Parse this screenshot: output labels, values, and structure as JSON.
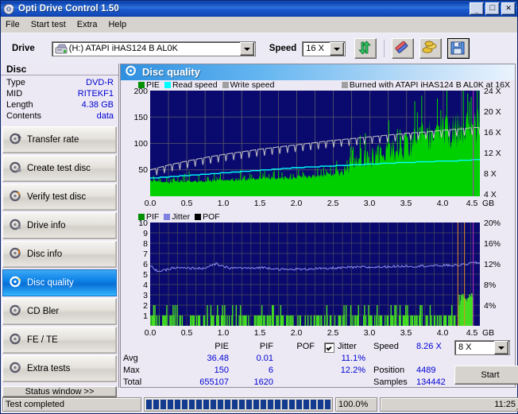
{
  "window": {
    "title": "Opti Drive Control 1.50",
    "icon": "disc-icon",
    "minimize": "_",
    "maximize": "□",
    "close": "✕"
  },
  "menu": {
    "items": [
      "File",
      "Start test",
      "Extra",
      "Help"
    ]
  },
  "toolbar": {
    "drive_label": "Drive",
    "drive_value": "(H:)  ATAPI iHAS124   B AL0K",
    "speed_label": "Speed",
    "speed_value": "16 X",
    "buttons": [
      {
        "name": "refresh-button",
        "icon": "refresh-icon"
      },
      {
        "name": "erase-button",
        "icon": "eraser-icon"
      },
      {
        "name": "bitsetting-button",
        "icon": "coins-icon"
      },
      {
        "name": "save-button",
        "icon": "floppy-save-icon"
      }
    ]
  },
  "sidebar": {
    "disc_header": "Disc",
    "disc_info": [
      {
        "key": "Type",
        "value": "DVD-R"
      },
      {
        "key": "MID",
        "value": "RITEKF1"
      },
      {
        "key": "Length",
        "value": "4.38 GB"
      },
      {
        "key": "Contents",
        "value": "data"
      }
    ],
    "nav": [
      {
        "label": "Transfer rate",
        "active": false
      },
      {
        "label": "Create test disc",
        "active": false
      },
      {
        "label": "Verify test disc",
        "active": false
      },
      {
        "label": "Drive info",
        "active": false
      },
      {
        "label": "Disc info",
        "active": false
      },
      {
        "label": "Disc quality",
        "active": true
      },
      {
        "label": "CD Bler",
        "active": false
      },
      {
        "label": "FE / TE",
        "active": false
      },
      {
        "label": "Extra tests",
        "active": false
      }
    ],
    "status_window_button": "Status window >>"
  },
  "panel": {
    "title": "Disc quality",
    "icon": "disc-quality-icon"
  },
  "chart_data": [
    {
      "type": "area",
      "id": "pie-chart",
      "title": "",
      "legend": [
        {
          "label": "PIE",
          "color": "#009000"
        },
        {
          "label": "Read speed",
          "color": "#00ffff"
        },
        {
          "label": "Write speed",
          "color": "#a0a0a0"
        }
      ],
      "annotation": {
        "label": "Burned with ATAPI iHAS124   B AL0K at 16X",
        "color": "#a0a0a0"
      },
      "xlabel": "GB",
      "x_ticks": [
        "0.0",
        "0.5",
        "1.0",
        "1.5",
        "2.0",
        "2.5",
        "3.0",
        "3.5",
        "4.0",
        "4.5"
      ],
      "xlim": [
        0.0,
        4.5
      ],
      "ylabel_left": "PIE",
      "y_ticks_left": [
        "50",
        "100",
        "150",
        "200"
      ],
      "ylim_left": [
        0,
        200
      ],
      "ylabel_right": "Speed",
      "y_ticks_right": [
        "4 X",
        "8 X",
        "12 X",
        "16 X",
        "20 X",
        "24 X"
      ],
      "ylim_right": [
        0,
        24
      ],
      "grid": true,
      "plot_bg": "#0a0a6e",
      "series": [
        {
          "name": "PIE",
          "color": "#00d000",
          "x": [
            0.0,
            0.1,
            0.2,
            0.3,
            0.4,
            0.5,
            0.6,
            0.7,
            0.8,
            0.9,
            1.0,
            1.1,
            1.2,
            1.3,
            1.4,
            1.5,
            1.6,
            1.7,
            1.8,
            1.9,
            2.0,
            2.1,
            2.2,
            2.3,
            2.4,
            2.5,
            2.6,
            2.7,
            2.8,
            2.9,
            3.0,
            3.1,
            3.2,
            3.3,
            3.4,
            3.5,
            3.6,
            3.7,
            3.8,
            3.9,
            4.0,
            4.1,
            4.2,
            4.3,
            4.4
          ],
          "values": [
            30,
            27,
            26,
            27,
            28,
            28,
            29,
            29,
            30,
            30,
            31,
            31,
            32,
            33,
            33,
            34,
            34,
            35,
            34,
            35,
            36,
            37,
            38,
            38,
            40,
            44,
            52,
            58,
            62,
            66,
            70,
            76,
            82,
            86,
            92,
            98,
            104,
            110,
            112,
            118,
            120,
            126,
            130,
            132,
            136
          ]
        },
        {
          "name": "Read speed",
          "color": "#00ffff",
          "x": [
            0.0,
            0.25,
            0.5,
            0.75,
            1.0,
            1.25,
            1.5,
            1.75,
            2.0,
            2.25,
            2.5,
            2.75,
            3.0,
            3.25,
            3.5,
            3.75,
            4.0,
            4.25,
            4.4
          ],
          "values": [
            4.1,
            4.4,
            4.7,
            5.0,
            5.3,
            5.6,
            5.9,
            6.2,
            6.5,
            6.7,
            6.9,
            7.1,
            7.3,
            7.5,
            7.7,
            7.8,
            8.0,
            8.1,
            8.26
          ]
        },
        {
          "name": "Write speed",
          "color": "#b8b8b8",
          "x": [
            0.0,
            0.25,
            0.5,
            0.75,
            1.0,
            1.25,
            1.5,
            1.75,
            2.0,
            2.25,
            2.5,
            2.75,
            3.0,
            3.25,
            3.5,
            3.75,
            4.0,
            4.25,
            4.4
          ],
          "values": [
            6.0,
            7.1,
            8.0,
            8.8,
            9.5,
            10.1,
            10.7,
            11.2,
            11.7,
            12.2,
            12.7,
            13.1,
            13.5,
            13.9,
            14.3,
            14.6,
            15.0,
            15.3,
            15.6
          ]
        }
      ]
    },
    {
      "type": "bar",
      "id": "pif-chart",
      "title": "",
      "legend": [
        {
          "label": "PIF",
          "color": "#009000"
        },
        {
          "label": "Jitter",
          "color": "#8080e0"
        },
        {
          "label": "POF",
          "color": "#000000"
        }
      ],
      "xlabel": "GB",
      "x_ticks": [
        "0.0",
        "0.5",
        "1.0",
        "1.5",
        "2.0",
        "2.5",
        "3.0",
        "3.5",
        "4.0",
        "4.5"
      ],
      "xlim": [
        0.0,
        4.5
      ],
      "ylabel_left": "PIF",
      "y_ticks_left": [
        "1",
        "2",
        "3",
        "4",
        "5",
        "6",
        "7",
        "8",
        "9",
        "10"
      ],
      "ylim_left": [
        0,
        10
      ],
      "ylabel_right": "Jitter",
      "y_ticks_right": [
        "4%",
        "8%",
        "12%",
        "16%",
        "20%"
      ],
      "ylim_right": [
        0,
        20
      ],
      "grid": true,
      "plot_bg": "#0a0a6e",
      "series": [
        {
          "name": "Jitter",
          "color": "#8888ee",
          "x": [
            0.0,
            0.1,
            0.2,
            0.3,
            0.4,
            0.5,
            0.6,
            0.7,
            0.8,
            0.9,
            1.0,
            1.1,
            1.2,
            1.3,
            1.4,
            1.5,
            1.6,
            1.7,
            1.8,
            1.9,
            2.0,
            2.1,
            2.2,
            2.3,
            2.4,
            2.5,
            2.6,
            2.7,
            2.8,
            2.9,
            3.0,
            3.1,
            3.2,
            3.3,
            3.4,
            3.5,
            3.6,
            3.7,
            3.8,
            3.9,
            4.0,
            4.1,
            4.2,
            4.3,
            4.4
          ],
          "values": [
            11.6,
            10.6,
            10.7,
            11.2,
            11.2,
            11.1,
            11.2,
            11.1,
            11.4,
            12.0,
            11.4,
            11.2,
            11.2,
            11.2,
            11.1,
            11.3,
            11.2,
            11.1,
            10.9,
            10.9,
            11.0,
            10.9,
            11.1,
            11.1,
            11.0,
            11.2,
            11.2,
            11.3,
            11.3,
            11.4,
            11.3,
            11.4,
            11.4,
            11.5,
            11.5,
            11.6,
            11.5,
            11.6,
            11.6,
            11.6,
            11.7,
            11.7,
            11.7,
            11.9,
            12.2
          ]
        },
        {
          "name": "PIF",
          "color": "#00d000",
          "note": "sparse spikes mostly 1-2, rising to 3 near 4.3 GB"
        }
      ]
    }
  ],
  "stats": {
    "columns": [
      "PIE",
      "PIF",
      "POF",
      "Jitter"
    ],
    "jitter_checkbox_checked": true,
    "rows": [
      {
        "label": "Avg",
        "pie": "36.48",
        "pif": "0.01",
        "pof": "",
        "jitter": "11.1%"
      },
      {
        "label": "Max",
        "pie": "150",
        "pif": "6",
        "pof": "",
        "jitter": "12.2%"
      },
      {
        "label": "Total",
        "pie": "655107",
        "pif": "1620",
        "pof": "",
        "jitter": ""
      }
    ],
    "info": [
      {
        "key": "Speed",
        "value": "8.26 X"
      },
      {
        "key": "Position",
        "value": "4489"
      },
      {
        "key": "Samples",
        "value": "134442"
      }
    ],
    "speed_select_value": "8 X",
    "start_button": "Start"
  },
  "statusbar": {
    "message": "Test completed",
    "progress_percent": "100.0%",
    "progress_value": 100,
    "time": "11:25"
  }
}
